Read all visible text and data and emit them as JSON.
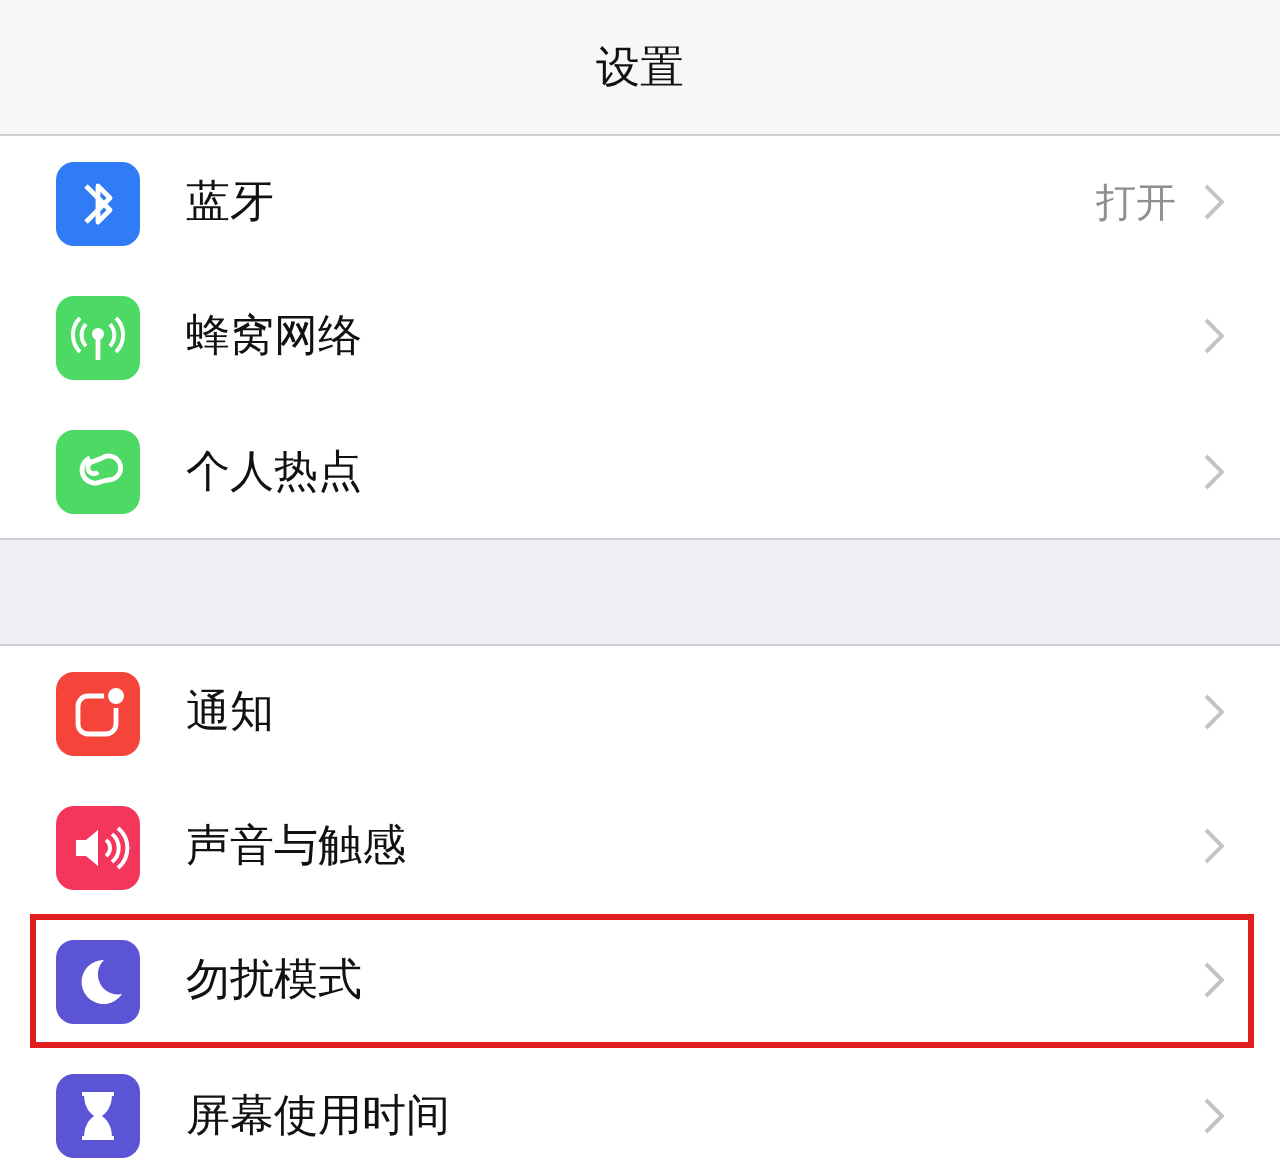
{
  "title": "设置",
  "groups": [
    {
      "items": [
        {
          "label": "蓝牙",
          "value": "打开",
          "kind": "bluetooth",
          "color": "#2f7cf6",
          "highlighted": false
        },
        {
          "label": "蜂窝网络",
          "kind": "antenna",
          "color": "#4cd964",
          "highlighted": false
        },
        {
          "label": "个人热点",
          "kind": "link",
          "color": "#4cd964",
          "highlighted": false
        }
      ]
    },
    {
      "items": [
        {
          "label": "通知",
          "kind": "notification",
          "color": "#f5453a",
          "highlighted": false
        },
        {
          "label": "声音与触感",
          "kind": "speaker",
          "color": "#f5365c",
          "highlighted": false
        },
        {
          "label": "勿扰模式",
          "kind": "moon",
          "color": "#5b55d6",
          "highlighted": true
        },
        {
          "label": "屏幕使用时间",
          "kind": "hourglass",
          "color": "#5b55d6",
          "highlighted": false
        }
      ]
    }
  ]
}
